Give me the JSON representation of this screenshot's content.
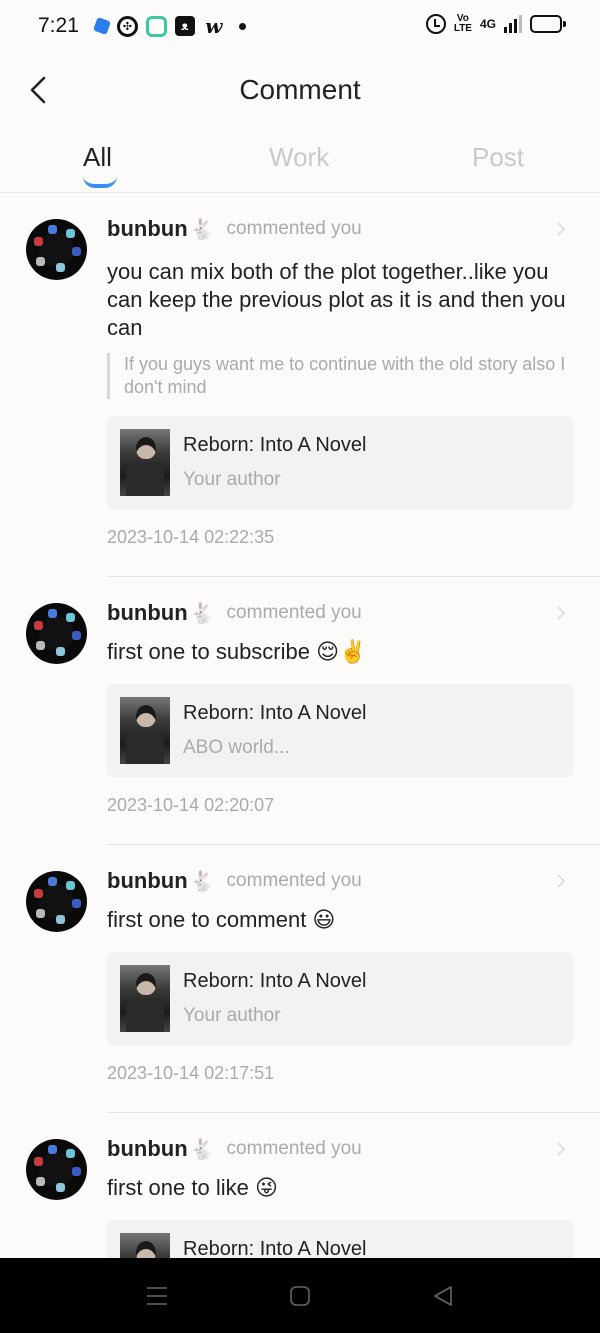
{
  "status_bar": {
    "time": "7:21",
    "network": "4G"
  },
  "header": {
    "title": "Comment"
  },
  "tabs": [
    {
      "label": "All",
      "active": true
    },
    {
      "label": "Work",
      "active": false
    },
    {
      "label": "Post",
      "active": false
    }
  ],
  "colors": {
    "accent": "#3a8ef6",
    "muted": "#aaaaaa",
    "card_bg": "#f2f2f2"
  },
  "comments": [
    {
      "user": "bunbun",
      "action": "commented you",
      "text": "you can mix both of the plot together..like you can keep the previous plot as it is and then you can",
      "quote": "If you guys want me to continue with the old story also I don't mind",
      "work_title": "Reborn: Into A Novel",
      "work_sub": "Your author",
      "time": "2023-10-14 02:22:35"
    },
    {
      "user": "bunbun",
      "action": "commented you",
      "text": "first one to subscribe 😌✌️",
      "work_title": "Reborn: Into A Novel",
      "work_sub": "ABO world...",
      "time": "2023-10-14 02:20:07"
    },
    {
      "user": "bunbun",
      "action": "commented you",
      "text": "first one to comment 😃",
      "work_title": "Reborn: Into A Novel",
      "work_sub": "Your author",
      "time": "2023-10-14 02:17:51"
    },
    {
      "user": "bunbun",
      "action": "commented you",
      "text": "first one to like 😜",
      "work_title": "Reborn: Into A Novel"
    }
  ]
}
